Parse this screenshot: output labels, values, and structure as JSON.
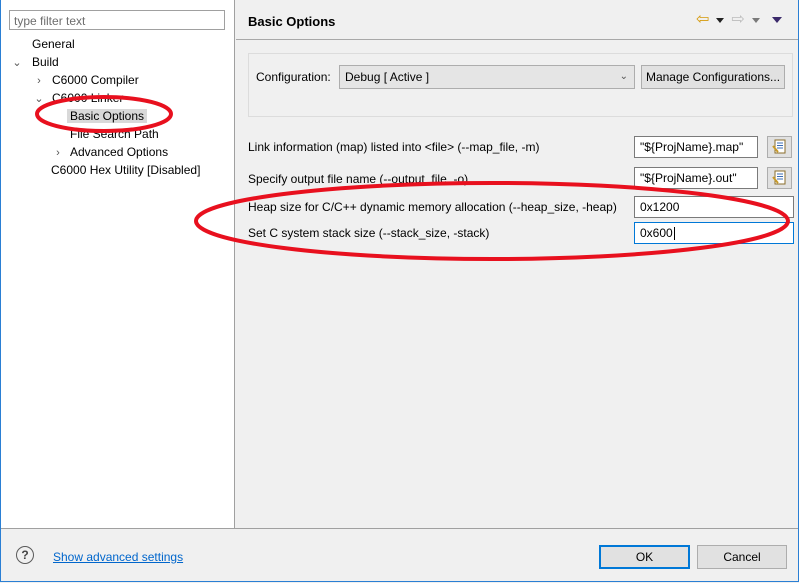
{
  "sidebar": {
    "filter_placeholder": "type filter text",
    "items": [
      {
        "label": "General",
        "level": 1,
        "twisty": ""
      },
      {
        "label": "Build",
        "level": 0,
        "twisty": "expanded"
      },
      {
        "label": "C6000 Compiler",
        "level": 1,
        "twisty": "collapsed"
      },
      {
        "label": "C6000 Linker",
        "level": 1,
        "twisty": "expanded"
      },
      {
        "label": "Basic Options",
        "level": 2,
        "twisty": "",
        "selected": true
      },
      {
        "label": "File Search Path",
        "level": 2,
        "twisty": ""
      },
      {
        "label": "Advanced Options",
        "level": 2,
        "twisty": "collapsed"
      },
      {
        "label": "C6000 Hex Utility  [Disabled]",
        "level": 1,
        "twisty": ""
      }
    ]
  },
  "header": {
    "title": "Basic Options",
    "icons": [
      "back-arrow-icon",
      "back-menu-icon",
      "forward-arrow-icon",
      "forward-menu-icon",
      "view-menu-icon"
    ]
  },
  "configuration": {
    "label": "Configuration:",
    "selected": "Debug  [ Active ]",
    "manage_button": "Manage Configurations..."
  },
  "options": [
    {
      "label": "Link information (map) listed into <file> (--map_file, -m)",
      "value": "\"${ProjName}.map\"",
      "has_variables_button": true
    },
    {
      "label": "Specify output file name (--output_file, -o)",
      "value": "\"${ProjName}.out\"",
      "has_variables_button": true
    },
    {
      "label": "Heap size for C/C++ dynamic memory allocation (--heap_size, -heap)",
      "value": "0x1200",
      "has_variables_button": false
    },
    {
      "label": "Set C system stack size (--stack_size, -stack)",
      "value": "0x600",
      "has_variables_button": false,
      "focused": true
    }
  ],
  "footer": {
    "help_glyph": "?",
    "advanced_link": "Show advanced settings",
    "ok": "OK",
    "cancel": "Cancel"
  },
  "annotation_color": "#e8101e"
}
